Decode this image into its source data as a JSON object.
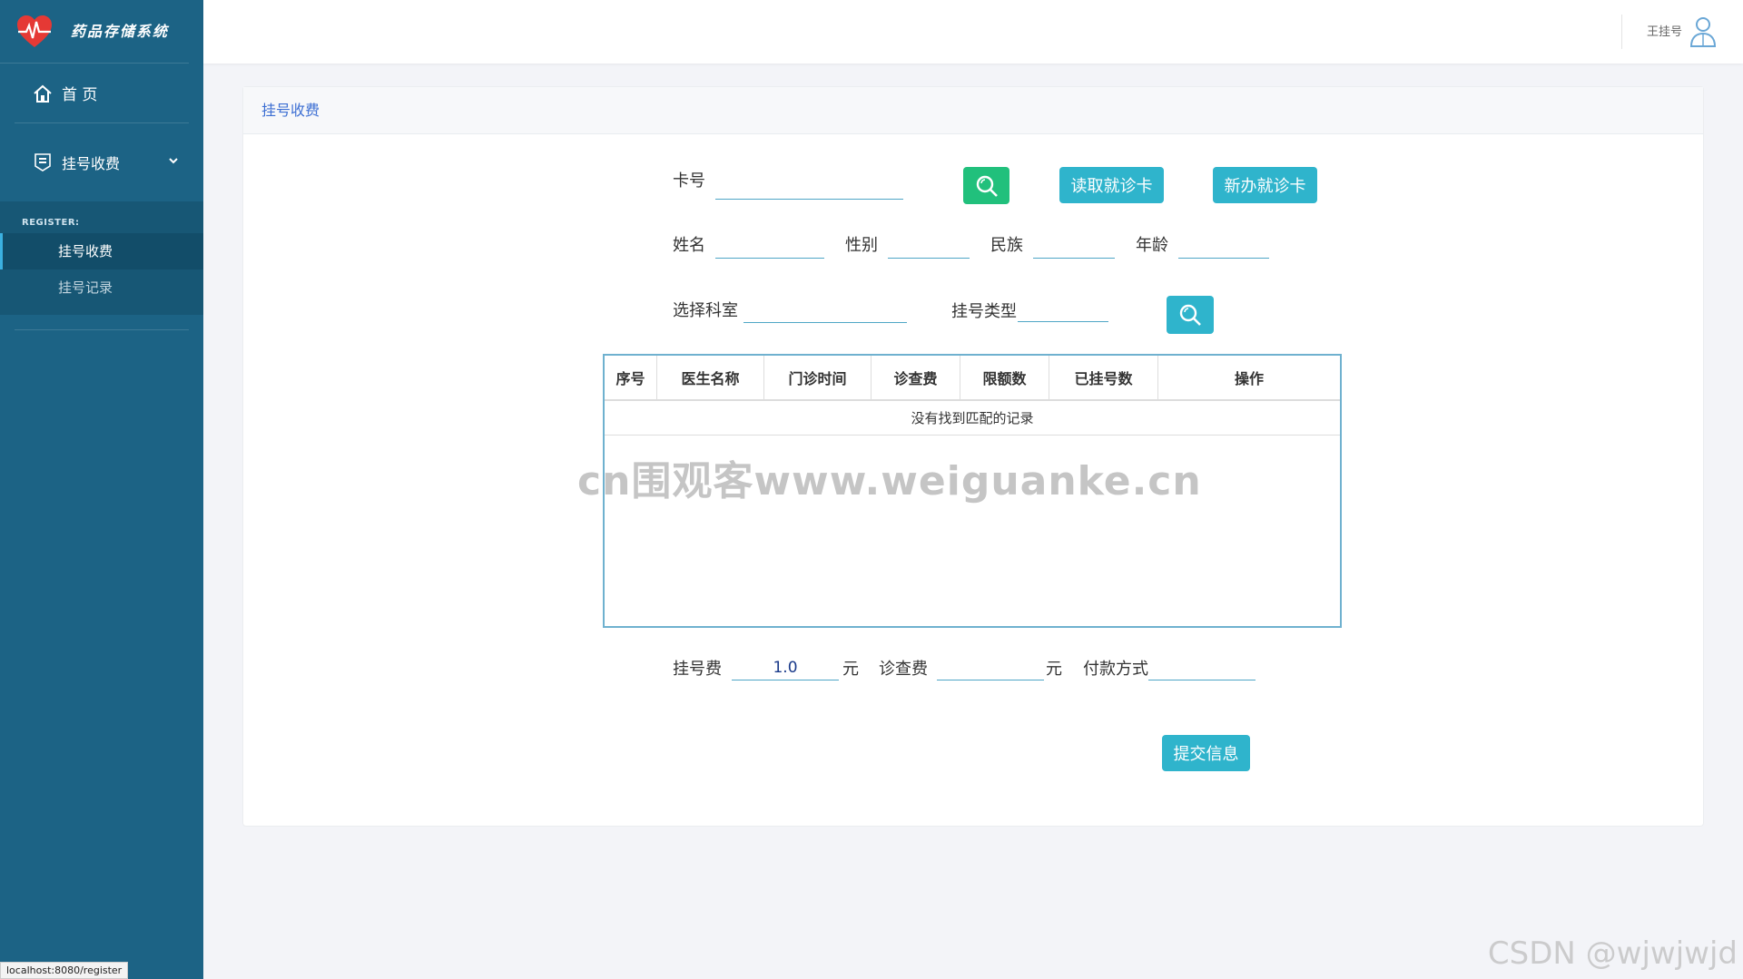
{
  "sidebar": {
    "brand_title": "药品存储系统",
    "home_label": "首 页",
    "menu_label": "挂号收费",
    "section_label": "REGISTER:",
    "items": [
      {
        "label": "挂号收费",
        "active": true
      },
      {
        "label": "挂号记录",
        "active": false
      }
    ],
    "status_url": "localhost:8080/register"
  },
  "topbar": {
    "user_name": "王挂号"
  },
  "card": {
    "title": "挂号收费"
  },
  "form": {
    "card_label": "卡号",
    "card_value": "",
    "read_card_button": "读取就诊卡",
    "new_card_button": "新办就诊卡",
    "name_label": "姓名",
    "gender_label": "性别",
    "ethnicity_label": "民族",
    "age_label": "年龄",
    "dept_label": "选择科室",
    "reg_type_label": "挂号类型",
    "reg_fee_label": "挂号费",
    "reg_fee_value": "1.0",
    "yuan1": "元",
    "exam_fee_label": "诊查费",
    "exam_fee_value": "",
    "yuan2": "元",
    "payment_label": "付款方式",
    "submit_button": "提交信息"
  },
  "table": {
    "columns": [
      "序号",
      "医生名称",
      "门诊时间",
      "诊查费",
      "限额数",
      "已挂号数",
      "操作"
    ],
    "empty_text": "没有找到匹配的记录"
  },
  "watermarks": {
    "center": "cn围观客www.weiguanke.cn",
    "corner": "CSDN @wjwjwjd"
  },
  "colors": {
    "sidebar": "#1c6385",
    "accent_green": "#21c07c",
    "accent_teal": "#2fb4cc",
    "title_blue": "#3d6fd3"
  }
}
